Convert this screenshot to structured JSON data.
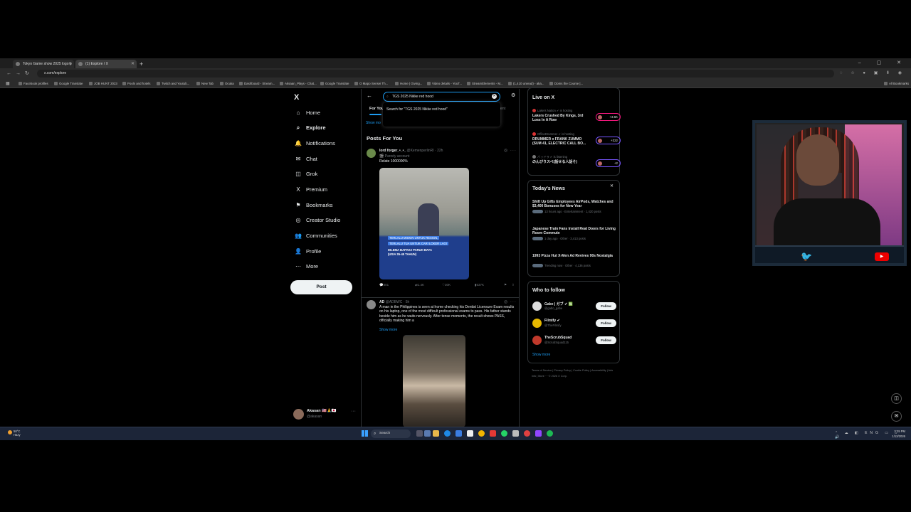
{
  "browser": {
    "tabs": [
      {
        "title": "Tokyo Game show 2025 logo p"
      },
      {
        "title": "(1) Explore / X"
      }
    ],
    "new_tab": "+",
    "window_controls": "– ▢ ✕",
    "url": "x.com/explore",
    "extensions": "◌ ☆ ● ▣ ⬇ ◉",
    "bookmarks": [
      "Facebook profiles",
      "Google Translate",
      "JOB HUNT 2023",
      "Pools and hotels",
      "Twitch and Youtub...",
      "New Tab",
      "Ocuka",
      "Dashboard - Stream...",
      "Aksaan_Plays - Chat...",
      "Google Translate",
      "O Mapo Sensei Th...",
      "Home | Giving...",
      "Video details - YouT...",
      "StreamElements - M...",
      "(1,410 unread) - aka...",
      "Doms the Course |..."
    ],
    "all_bookmarks": "All Bookmarks"
  },
  "sidebar": {
    "logo": "X",
    "nav": [
      {
        "label": "Home",
        "icon": "⌂"
      },
      {
        "label": "Explore",
        "icon": "⌕"
      },
      {
        "label": "Notifications",
        "icon": "🔔"
      },
      {
        "label": "Chat",
        "icon": "✉"
      },
      {
        "label": "Grok",
        "icon": "◫"
      },
      {
        "label": "Premium",
        "icon": "X"
      },
      {
        "label": "Bookmarks",
        "icon": "⚑"
      },
      {
        "label": "Creator Studio",
        "icon": "◎"
      },
      {
        "label": "Communities",
        "icon": "👥"
      },
      {
        "label": "Profile",
        "icon": "👤"
      },
      {
        "label": "More",
        "icon": "⋯"
      }
    ],
    "post_button": "Post",
    "account": {
      "name": "Akasan 🇺🇸🙏🇯🇵",
      "handle": "@akasan",
      "more": "···"
    }
  },
  "search": {
    "back": "←",
    "query": "TGS 2025 Nikke red hood",
    "suggestion": "Search for \"TGS 2025 Nikke red hood\"",
    "clear": "✕",
    "settings_icon": "⚙"
  },
  "explore_tabs": {
    "for_you": "For You",
    "entertainment": "ment"
  },
  "show_more_top": "Show mo",
  "feed": {
    "section_title": "Posts For You",
    "posts": [
      {
        "name": "lord forger_•_•_",
        "handle": "@KemenperlinRI · 22h",
        "sub": "🎬 Parody account",
        "text": "Relate 1000000%",
        "media_lines": [
          "TERLALU MISKIN UNTUK RESIGN,",
          "TERLALU TUA UNTUK CARI LOKER LAGI",
          "DILEMA BAPAK2 PARUH BAYA",
          "(USIA 35-45 TAHUN)"
        ],
        "stats": {
          "replies": "301",
          "reposts": "1.4K",
          "likes": "30K",
          "views": "537K"
        }
      },
      {
        "name": "AD",
        "handle": "@ADBWC · 5h",
        "text": "A man in the Philippines is seen at home checking his Dentist Licensure Exam results on his laptop, one of the most difficult professional exams to pass. His father stands beside him as he waits nervously. After tense moments, the result shows PASS, officially making him a",
        "show_more": "Show more"
      }
    ]
  },
  "live": {
    "title": "Live on X",
    "items": [
      {
        "host": "Lakers Nation ✔ is hosting",
        "title": "Lakers Crushed By Kings, 3rd Loss In A Row",
        "count": "+3.6K"
      },
      {
        "host": "OfficeDrummer ✔ is hosting",
        "title": "DRUMMER x FRANK ZUMMO (SUM 41, ELECTRIC CALL BO...",
        "count": "+322"
      },
      {
        "host": "バッドラ ✔ is listening",
        "title": "のんびりスペ(話せる人話そ)",
        "count": "+2"
      }
    ]
  },
  "news": {
    "title": "Today's News",
    "close": "✕",
    "items": [
      {
        "title": "Shift Up Gifts Employees AirPods, Watches and $3,400 Bonuses for New Year",
        "meta": "13 hours ago · Entertainment · 1,420 posts"
      },
      {
        "title": "Japanese Train Fans Install Real Doors for Living Room Commute",
        "meta": "1 day ago · Other · 3,413 posts"
      },
      {
        "title": "1993 Pizza Hut X-Men Ad Revives 90s Nostalgia",
        "meta": "Trending now · Other · 4,136 posts"
      }
    ]
  },
  "who_to_follow": {
    "title": "Who to follow",
    "items": [
      {
        "name": "Gabe | ガブ ✔ 🈯",
        "handle": "@gabo_gabe",
        "button": "Follow"
      },
      {
        "name": "Filmify ✔",
        "handle": "@TheFilmify",
        "button": "Follow"
      },
      {
        "name": "TheScrubSquad",
        "handle": "@ScrubSquad115",
        "button": "Follow"
      }
    ],
    "show_more": "Show more"
  },
  "footer": "Terms of Service | Privacy Policy | Cookie Policy | Accessibility | Ads info | More ··· © 2026 X Corp.",
  "floating": {
    "grok": "◫",
    "messages": "✉"
  },
  "taskbar": {
    "weather_temp": "58°C",
    "weather_desc": "Hazy",
    "search": "Search",
    "tray_lang": "ENG",
    "time": "3:29 PM",
    "date": "1/13/2026",
    "tray_icons": "⌃ ☁ ◧ ENG ▭ ⌂ 🔊"
  },
  "colors": {
    "accent": "#1d9bf0",
    "border": "#2f3336",
    "secondary_text": "#71767b",
    "live_badge": "#f91880",
    "taskbar": "#1c2538"
  }
}
